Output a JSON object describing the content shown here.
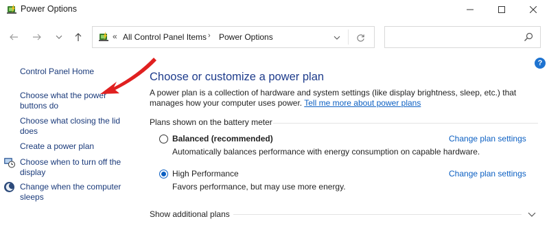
{
  "window": {
    "title": "Power Options"
  },
  "address": {
    "breadcrumb_root": "All Control Panel Items",
    "breadcrumb_current": "Power Options",
    "search_placeholder": ""
  },
  "sidebar": {
    "home": "Control Panel Home",
    "items": [
      {
        "label": "Choose what the power buttons do"
      },
      {
        "label": "Choose what closing the lid does"
      },
      {
        "label": "Create a power plan"
      },
      {
        "label": "Choose when to turn off the display"
      },
      {
        "label": "Change when the computer sleeps"
      }
    ]
  },
  "main": {
    "title": "Choose or customize a power plan",
    "description": "A power plan is a collection of hardware and system settings (like display brightness, sleep, etc.) that manages how your computer uses power.",
    "learn_more": "Tell me more about power plans",
    "group_label": "Plans shown on the battery meter",
    "plans": [
      {
        "name": "Balanced (recommended)",
        "description": "Automatically balances performance with energy consumption on capable hardware.",
        "link": "Change plan settings",
        "selected": false
      },
      {
        "name": "High Performance",
        "description": "Favors performance, but may use more energy.",
        "link": "Change plan settings",
        "selected": true
      }
    ],
    "additional": "Show additional plans"
  },
  "colors": {
    "accent": "#0b5fc2",
    "heading": "#1e3c8c",
    "arrow": "#e02020"
  }
}
